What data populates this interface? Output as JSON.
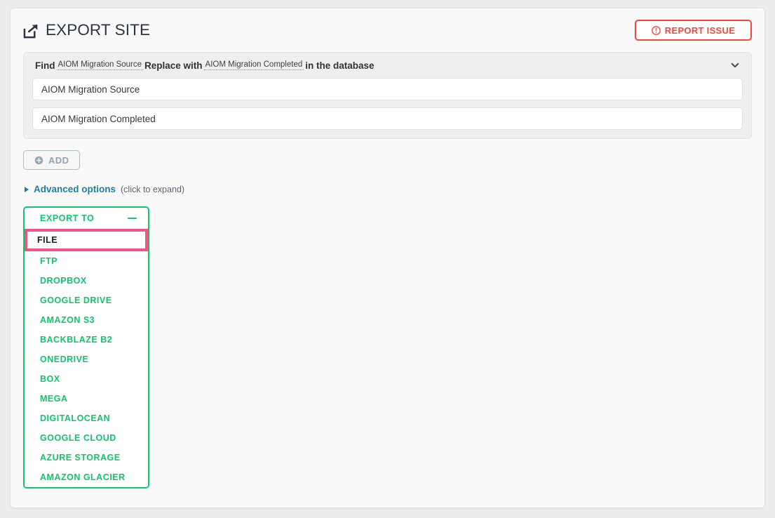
{
  "header": {
    "title": "EXPORT SITE",
    "export_icon": "share-export-icon",
    "report_issue": {
      "label": "REPORT ISSUE",
      "icon": "exclamation-circle-icon",
      "color": "#fa4438"
    }
  },
  "find_replace": {
    "summary": {
      "find_label": "Find",
      "find_value": "AIOM Migration Source",
      "replace_label": "Replace with",
      "replace_value": "AIOM Migration Completed",
      "suffix": "in the database"
    },
    "collapse_icon": "chevron-down-icon",
    "inputs": [
      {
        "name": "find-field",
        "value": "AIOM Migration Source",
        "placeholder": "Find"
      },
      {
        "name": "replace-field",
        "value": "AIOM Migration Completed",
        "placeholder": "Replace with"
      }
    ]
  },
  "add_button": {
    "label": "ADD",
    "icon": "plus-circle-icon"
  },
  "advanced": {
    "caret_icon": "caret-right-icon",
    "link": "Advanced options",
    "hint": "(click to expand)"
  },
  "export_to": {
    "heading": "EXPORT TO",
    "collapse_icon": "minus-icon",
    "accent_color": "#12c46d",
    "selected_color": "#f2547d",
    "selected": "FILE",
    "items": [
      {
        "label": "FILE",
        "selected": true
      },
      {
        "label": "FTP",
        "selected": false
      },
      {
        "label": "DROPBOX",
        "selected": false
      },
      {
        "label": "GOOGLE DRIVE",
        "selected": false
      },
      {
        "label": "AMAZON S3",
        "selected": false
      },
      {
        "label": "BACKBLAZE B2",
        "selected": false
      },
      {
        "label": "ONEDRIVE",
        "selected": false
      },
      {
        "label": "BOX",
        "selected": false
      },
      {
        "label": "MEGA",
        "selected": false
      },
      {
        "label": "DIGITALOCEAN",
        "selected": false
      },
      {
        "label": "GOOGLE CLOUD",
        "selected": false
      },
      {
        "label": "AZURE STORAGE",
        "selected": false
      },
      {
        "label": "AMAZON GLACIER",
        "selected": false
      }
    ]
  }
}
